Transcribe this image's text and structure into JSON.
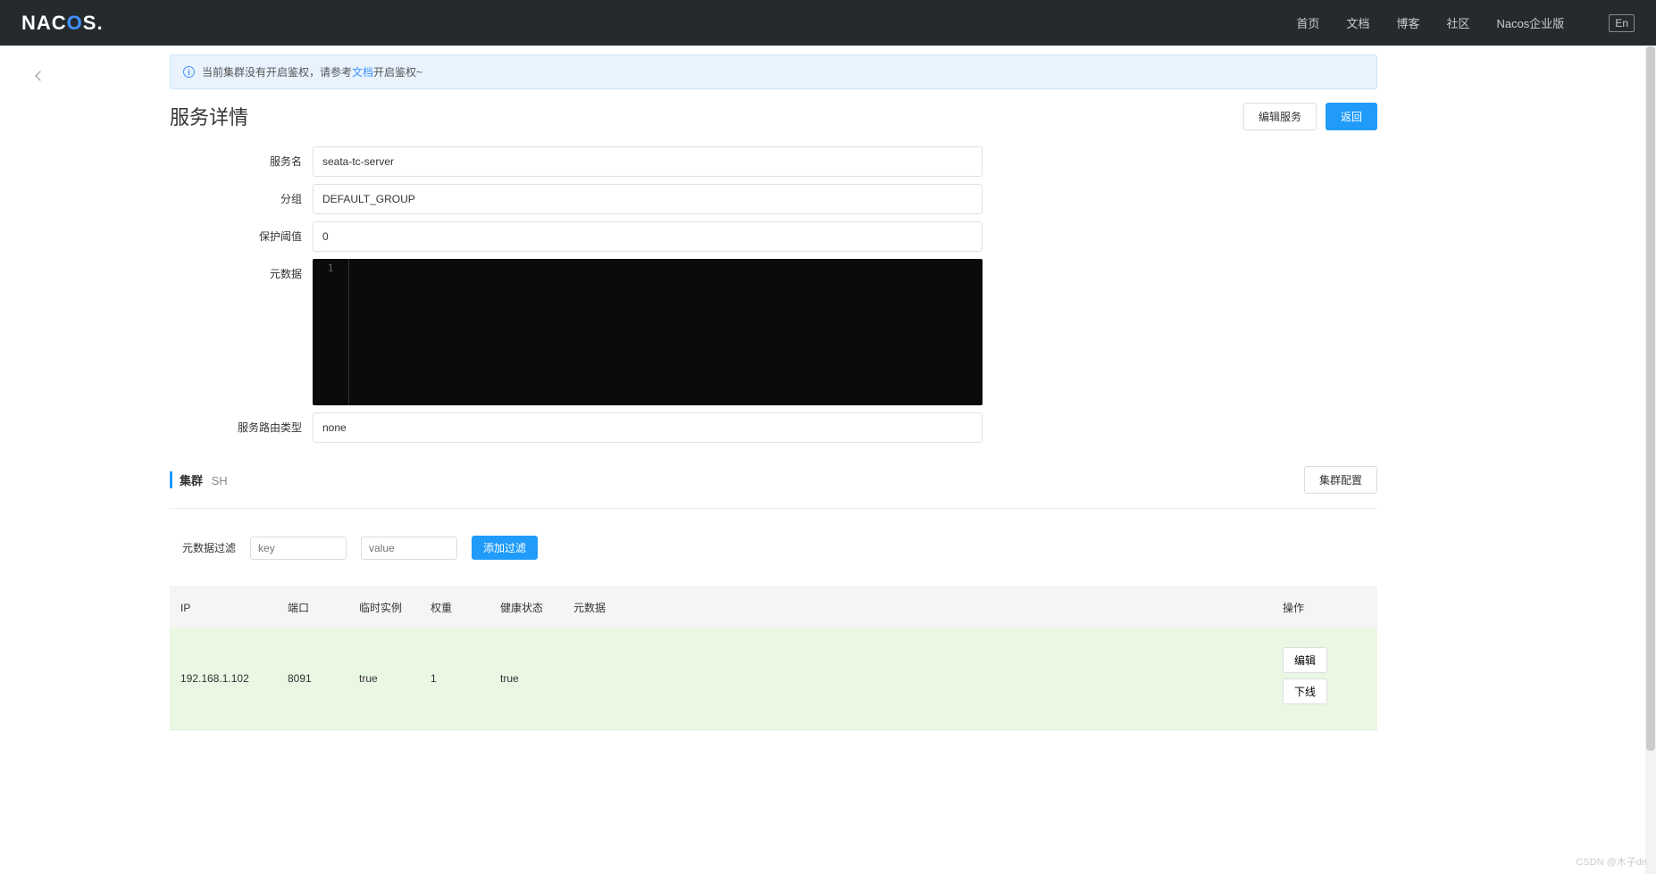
{
  "topnav": {
    "links": [
      "首页",
      "文档",
      "博客",
      "社区",
      "Nacos企业版"
    ],
    "lang": "En"
  },
  "alert": {
    "prefix": "当前集群没有开启鉴权，请参考",
    "link": "文档",
    "suffix": "开启鉴权~"
  },
  "page": {
    "title": "服务详情",
    "edit_btn": "编辑服务",
    "back_btn": "返回"
  },
  "form": {
    "service_name_label": "服务名",
    "service_name": "seata-tc-server",
    "group_label": "分组",
    "group": "DEFAULT_GROUP",
    "threshold_label": "保护阈值",
    "threshold": "0",
    "metadata_label": "元数据",
    "metadata_line_no": "1",
    "selector_label": "服务路由类型",
    "selector": "none"
  },
  "cluster": {
    "title": "集群",
    "name": "SH",
    "config_btn": "集群配置"
  },
  "filter": {
    "label": "元数据过滤",
    "key_placeholder": "key",
    "value_placeholder": "value",
    "add_btn": "添加过滤"
  },
  "table": {
    "headers": {
      "ip": "IP",
      "port": "端口",
      "ephemeral": "临时实例",
      "weight": "权重",
      "healthy": "健康状态",
      "metadata": "元数据",
      "actions": "操作"
    },
    "row": {
      "ip": "192.168.1.102",
      "port": "8091",
      "ephemeral": "true",
      "weight": "1",
      "healthy": "true",
      "metadata": ""
    },
    "actions": {
      "edit": "编辑",
      "offline": "下线"
    }
  },
  "watermark": "CSDN @木子dn"
}
